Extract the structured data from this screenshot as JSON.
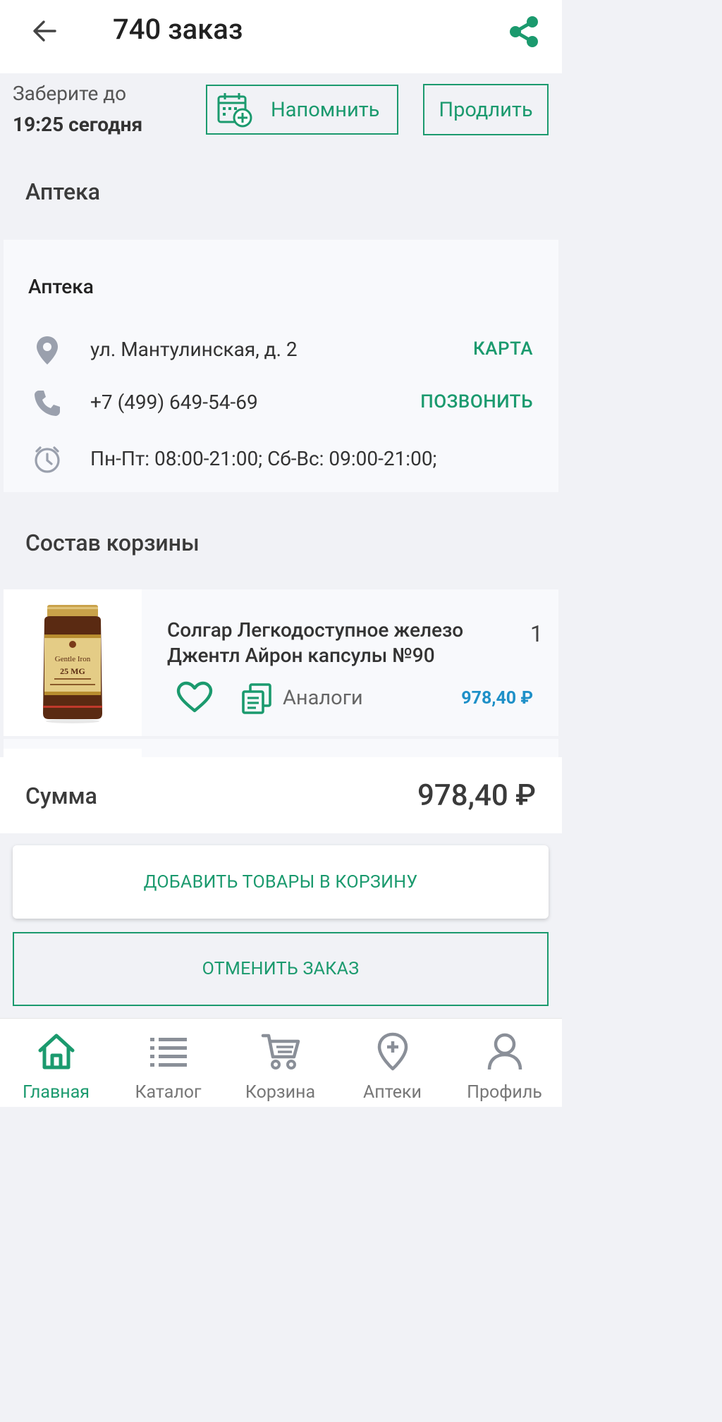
{
  "header": {
    "title": "740 заказ"
  },
  "pickup": {
    "label": "Заберите до",
    "time": "19:25 сегодня",
    "remind_label": "Напомнить",
    "extend_label": "Продлить"
  },
  "pharmacy_section": {
    "title": "Аптека",
    "name": "Аптека",
    "address": "ул. Мантулинская, д. 2",
    "map_action": "КАРТА",
    "phone": "+7 (499) 649-54-69",
    "call_action": "ПОЗВОНИТЬ",
    "hours": "Пн-Пт: 08:00-21:00; Сб-Вс: 09:00-21:00;"
  },
  "cart": {
    "title": "Состав корзины",
    "items": [
      {
        "name": "Солгар Легкодоступное железо Джентл Айрон капсулы №90",
        "quantity": "1",
        "analogs_label": "Аналоги",
        "price": "978,40 ₽",
        "label_brand": "Gentle Iron",
        "label_dose": "25 MG"
      }
    ]
  },
  "summary": {
    "label": "Сумма",
    "value": "978,40 ₽"
  },
  "actions": {
    "add_to_cart": "ДОБАВИТЬ ТОВАРЫ В КОРЗИНУ",
    "cancel_order": "ОТМЕНИТЬ ЗАКАЗ"
  },
  "nav": {
    "items": [
      {
        "label": "Главная",
        "icon": "home-icon",
        "active": true
      },
      {
        "label": "Каталог",
        "icon": "list-icon",
        "active": false
      },
      {
        "label": "Корзина",
        "icon": "cart-icon",
        "active": false
      },
      {
        "label": "Аптеки",
        "icon": "pharmacy-pin-icon",
        "active": false
      },
      {
        "label": "Профиль",
        "icon": "profile-icon",
        "active": false
      }
    ]
  },
  "colors": {
    "accent": "#1b9a6e",
    "price": "#1e90c8",
    "background": "#f1f2f6",
    "icon_gray": "#9aa0ad"
  }
}
